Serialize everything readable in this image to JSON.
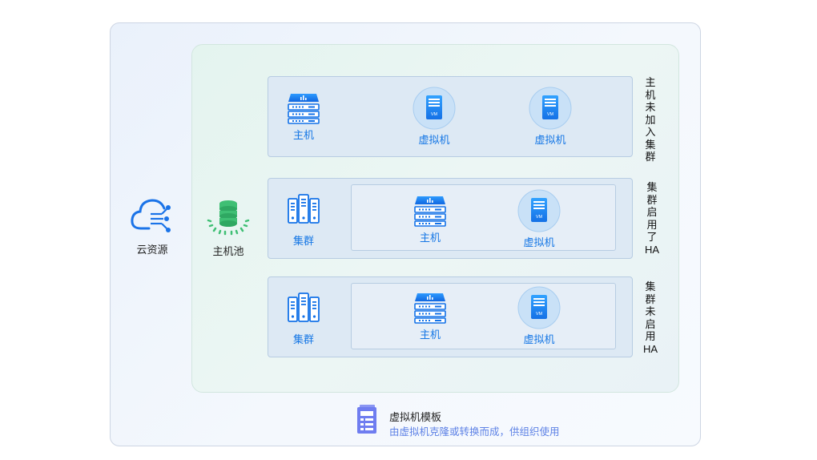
{
  "cloud_resource": {
    "label": "云资源",
    "icon": "cloud-network-icon"
  },
  "host_pool": {
    "label": "主机池",
    "icon": "database-stack-icon"
  },
  "rows": [
    {
      "side_label": [
        "主",
        "机",
        "未",
        "加",
        "入",
        "集",
        "群"
      ],
      "items": [
        {
          "label": "主机",
          "icon": "host-server-icon"
        },
        {
          "label": "虚拟机",
          "icon": "vm-icon"
        },
        {
          "label": "虚拟机",
          "icon": "vm-icon"
        }
      ]
    },
    {
      "side_label": [
        "集",
        "群",
        "启",
        "用",
        "了",
        "HA"
      ],
      "cluster": {
        "label": "集群",
        "icon": "cluster-servers-icon"
      },
      "items": [
        {
          "label": "主机",
          "icon": "host-server-icon"
        },
        {
          "label": "虚拟机",
          "icon": "vm-icon"
        }
      ]
    },
    {
      "side_label": [
        "集",
        "群",
        "未",
        "启",
        "用",
        "HA"
      ],
      "cluster": {
        "label": "集群",
        "icon": "cluster-servers-icon"
      },
      "items": [
        {
          "label": "主机",
          "icon": "host-server-icon"
        },
        {
          "label": "虚拟机",
          "icon": "vm-icon"
        }
      ]
    }
  ],
  "vm_badge": "VM",
  "template": {
    "title": "虚拟机模板",
    "description": "由虚拟机克隆或转换而成，供组织使用",
    "icon": "template-document-icon"
  },
  "colors": {
    "accent": "#1677e5",
    "green": "#3fbf74",
    "template_purple": "#6f7df0"
  }
}
